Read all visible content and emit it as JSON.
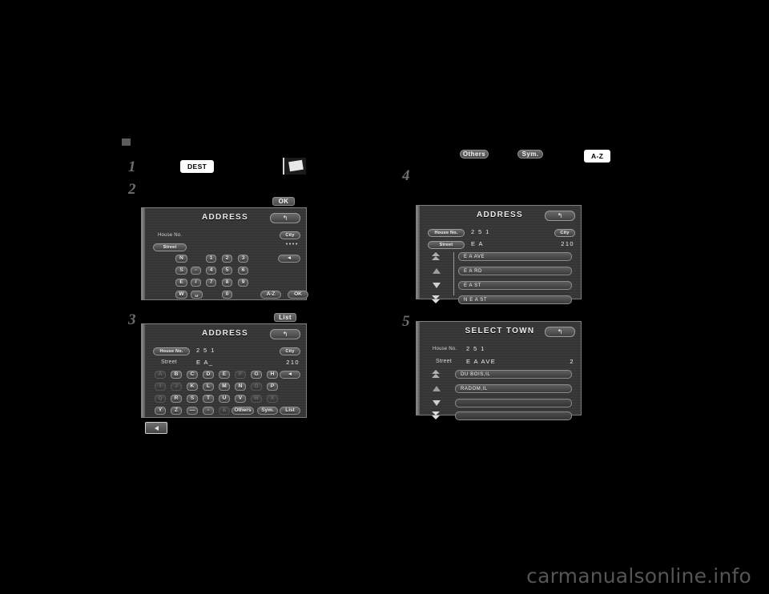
{
  "watermark": "carmanualsonline.info",
  "steps": {
    "marker": "",
    "one": "1",
    "two": "2",
    "three": "3",
    "four": "4",
    "five": "5"
  },
  "inline_buttons": {
    "dest": "DEST",
    "ok": "OK",
    "list": "List",
    "others": "Others",
    "sym": "Sym.",
    "az": "A-Z"
  },
  "icons": {
    "map_thumb": "map-thumbnail-icon",
    "back": "back-arrow-icon",
    "return": "↰"
  },
  "panel1": {
    "title": "ADDRESS",
    "return_label": "↰",
    "house_no_label": "House No.",
    "city_button": "City",
    "street_button": "Street",
    "masked_value": "••••",
    "keys_row1": [
      "N",
      "1",
      "2",
      "3"
    ],
    "keys_row2": [
      "S",
      "-",
      "4",
      "5",
      "6"
    ],
    "keys_row3": [
      "E",
      "/",
      "7",
      "8",
      "9"
    ],
    "keys_row4": [
      "W",
      "␣",
      "0"
    ],
    "backspace": "◄",
    "az_button": "A-Z",
    "ok_button": "OK"
  },
  "panel3": {
    "title": "ADDRESS",
    "return_label": "↰",
    "house_no_button": "House No.",
    "house_no_value": "2 5 1",
    "city_button": "City",
    "street_label": "Street",
    "street_value": "E   A_",
    "count": "210",
    "rowA": [
      "A",
      "B",
      "C",
      "D",
      "E",
      "F",
      "G",
      "H"
    ],
    "rowA_dim": [
      true,
      false,
      false,
      false,
      false,
      true,
      false,
      false
    ],
    "rowB": [
      "I",
      "J",
      "K",
      "L",
      "M",
      "N",
      "O",
      "P"
    ],
    "rowB_dim": [
      true,
      true,
      false,
      false,
      false,
      false,
      true,
      false
    ],
    "rowC": [
      "Q",
      "R",
      "S",
      "T",
      "U",
      "V",
      "W",
      "X"
    ],
    "rowC_dim": [
      true,
      false,
      false,
      false,
      false,
      false,
      true,
      true
    ],
    "rowD": [
      "Y",
      "Z",
      "—",
      "-",
      "&"
    ],
    "rowD_dim": [
      false,
      false,
      false,
      false,
      true
    ],
    "backspace": "◄",
    "others_button": "Others",
    "sym_button": "Sym.",
    "list_button": "List"
  },
  "panel4": {
    "title": "ADDRESS",
    "return_label": "↰",
    "house_no_button": "House No.",
    "house_no_value": "2 5 1",
    "city_button": "City",
    "street_button": "Street",
    "street_value": "E   A",
    "count": "210",
    "rows": [
      "E A AVE",
      "E A RD",
      "E A ST",
      "N E A ST"
    ]
  },
  "panel5": {
    "title": "SELECT TOWN",
    "return_label": "↰",
    "house_no_label": "House No.",
    "house_no_value": "2 5 1",
    "street_label": "Street",
    "street_value": "E   A   AVE",
    "count": "2",
    "rows": [
      "DU BOIS,IL",
      "RADOM,IL",
      "",
      ""
    ]
  }
}
